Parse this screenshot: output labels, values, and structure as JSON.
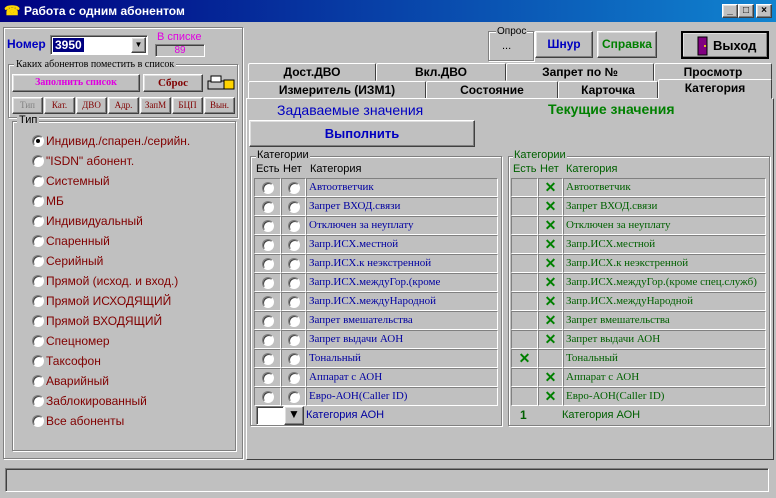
{
  "window": {
    "title": "Работа с одним абонентом"
  },
  "left": {
    "number_label": "Номер",
    "number_value": "3950",
    "in_list_label": "В списке",
    "in_list_value": "89",
    "which_group": "Каких абонентов поместить в список",
    "fill_btn": "Заполнить список",
    "reset_btn": "Сброс",
    "small_tabs": [
      "Тип",
      "Кат.",
      "ДВО",
      "Адр.",
      "ЗапМ",
      "БЦП",
      "Вын."
    ],
    "type_group": "Тип",
    "types": [
      "Индивид./спарен./серийн.",
      "\"ISDN\" абонент.",
      "Системный",
      "МБ",
      "Индивидуальный",
      "Спаренный",
      "Серийный",
      "Прямой (исход. и вход.)",
      "Прямой ИСХОДЯЩИЙ",
      "Прямой ВХОДЯЩИЙ",
      "Спецномер",
      "Таксофон",
      "Аварийный",
      "Заблокированный",
      "Все абоненты"
    ]
  },
  "top": {
    "poll_label": "Опрос",
    "poll_value": "...",
    "shnur_btn": "Шнур",
    "help_btn": "Справка",
    "exit_btn": "Выход"
  },
  "tabs": {
    "row1": [
      "Дост.ДВО",
      "Вкл.ДВО",
      "Запрет по №",
      "Просмотр"
    ],
    "row2": [
      "Измеритель (ИЗМ1)",
      "Состояние",
      "Карточка",
      "Категория"
    ]
  },
  "main": {
    "set_values": "Задаваемые значения",
    "current_values": "Текущие значения",
    "execute_btn": "Выполнить",
    "cat_group": "Категории",
    "col_yes": "Есть",
    "col_no": "Нет",
    "col_cat": "Категория",
    "categories": [
      "Автоответчик",
      "Запрет ВХОД.связи",
      "Отключен за неуплату",
      "Запр.ИСХ.местной",
      "Запр.ИСХ.к неэкстренной",
      "Запр.ИСХ.междуГор.(кроме",
      "Запр.ИСХ.междуНародной",
      "Запрет вмешательства",
      "Запрет выдачи АОН",
      "Тональный",
      "Аппарат с АОН",
      "Евро-АОН(Caller ID)"
    ],
    "categories_current": [
      "Автоответчик",
      "Запрет ВХОД.связи",
      "Отключен за неуплату",
      "Запр.ИСХ.местной",
      "Запр.ИСХ.к неэкстренной",
      "Запр.ИСХ.междуГор.(кроме спец.служб)",
      "Запр.ИСХ.междуНародной",
      "Запрет вмешательства",
      "Запрет выдачи АОН",
      "Тональный",
      "Аппарат с АОН",
      "Евро-АОН(Caller ID)"
    ],
    "current_marks": [
      "no",
      "no",
      "no",
      "no",
      "no",
      "no",
      "no",
      "no",
      "no",
      "yes",
      "no",
      "no"
    ],
    "aon_label": "Категория АОН",
    "aon_current_value": "1",
    "mark_glyph": "✕"
  }
}
